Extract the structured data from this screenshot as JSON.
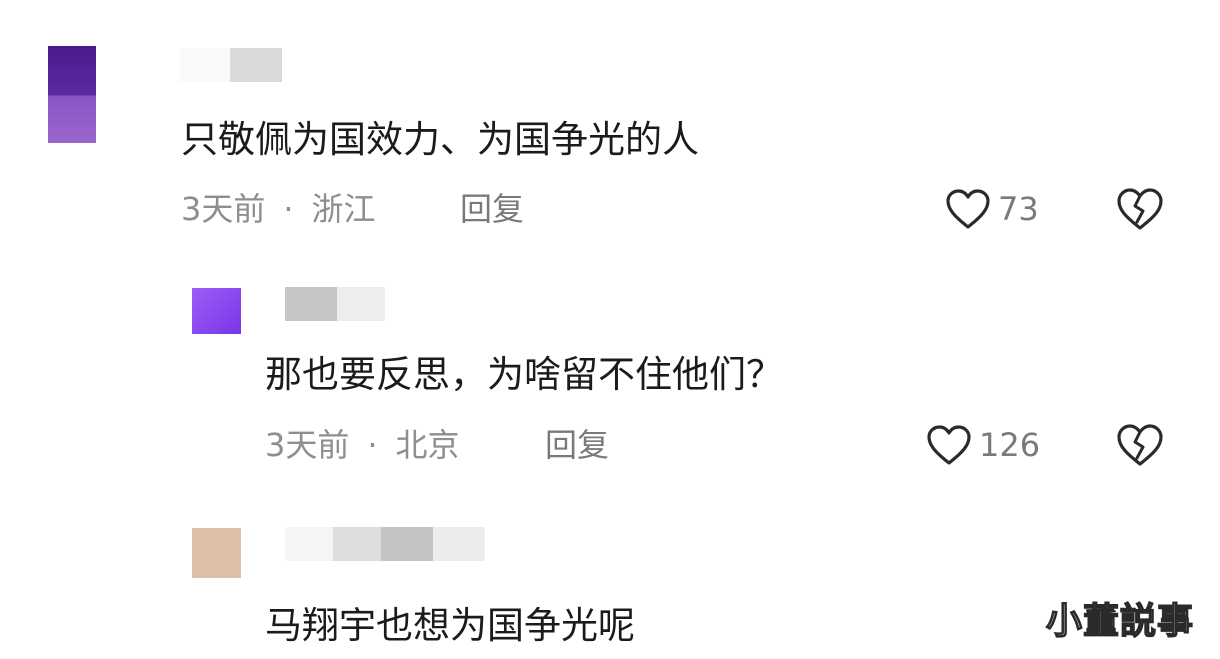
{
  "comments": [
    {
      "text": "只敬佩为国效力、为国争光的人",
      "time": "3天前",
      "location": "浙江",
      "reply_label": "回复",
      "likes": "73",
      "avatar_color": "#5a2aa0"
    },
    {
      "text": "那也要反思，为啥留不住他们？",
      "time": "3天前",
      "location": "北京",
      "reply_label": "回复",
      "likes": "126",
      "avatar_color": "#8a45f0"
    },
    {
      "text": "马翔宇也想为国争光呢",
      "avatar_color": "#dcbfa8"
    }
  ],
  "separator": "·",
  "icons": {
    "like": "heart-outline-icon",
    "dislike": "broken-heart-icon"
  },
  "watermark": "小董説事"
}
